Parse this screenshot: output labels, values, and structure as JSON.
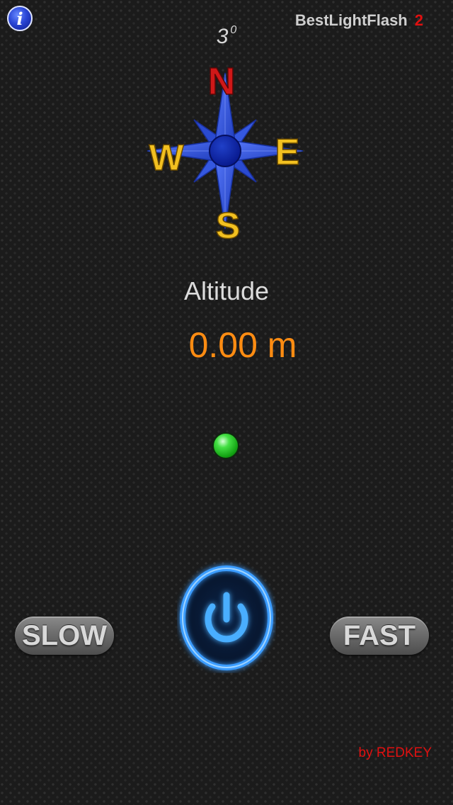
{
  "header": {
    "info_icon": "i",
    "app_name": "BestLightFlash",
    "app_version": "2"
  },
  "compass": {
    "heading_value": "3",
    "heading_unit": "0",
    "north": "N",
    "south": "S",
    "east": "E",
    "west": "W",
    "colors": {
      "rose": "#2b52d6",
      "rose_dark": "#0a2aa0",
      "north_letter": "#d01818",
      "other_letters": "#f2c020"
    }
  },
  "altitude": {
    "label": "Altitude",
    "value": "0.00 m"
  },
  "status": {
    "indicator_color": "#2ed02e"
  },
  "controls": {
    "slow_label": "SLOW",
    "fast_label": "FAST",
    "power_icon": "power-icon",
    "power_color": "#3aa0ff"
  },
  "footer": {
    "credit": "by REDKEY"
  }
}
